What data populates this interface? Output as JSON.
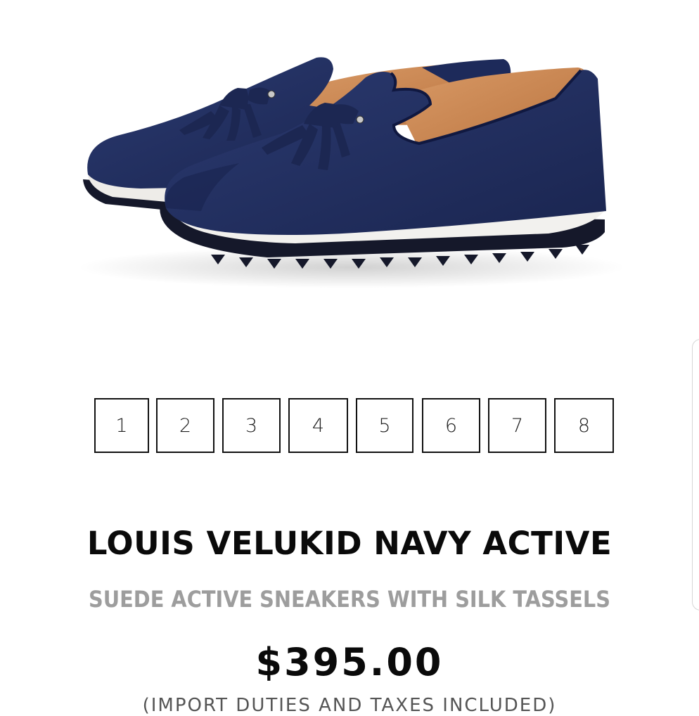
{
  "product": {
    "image_icon": "navy-suede-tassel-sneaker-icon",
    "gallery_pages": [
      "1",
      "2",
      "3",
      "4",
      "5",
      "6",
      "7",
      "8"
    ],
    "title": "LOUIS VELUKID NAVY ACTIVE",
    "subtitle": "SUEDE ACTIVE SNEAKERS WITH SILK TASSELS",
    "price": "$395.00",
    "price_note": "(IMPORT DUTIES AND TAXES INCLUDED)"
  },
  "colors": {
    "suede_navy": "#1f2d5c",
    "lining_tan": "#c98653",
    "sole_white": "#f2f1ee",
    "outsole_dark": "#15182a",
    "subtitle_gray": "#9d9d9d"
  }
}
